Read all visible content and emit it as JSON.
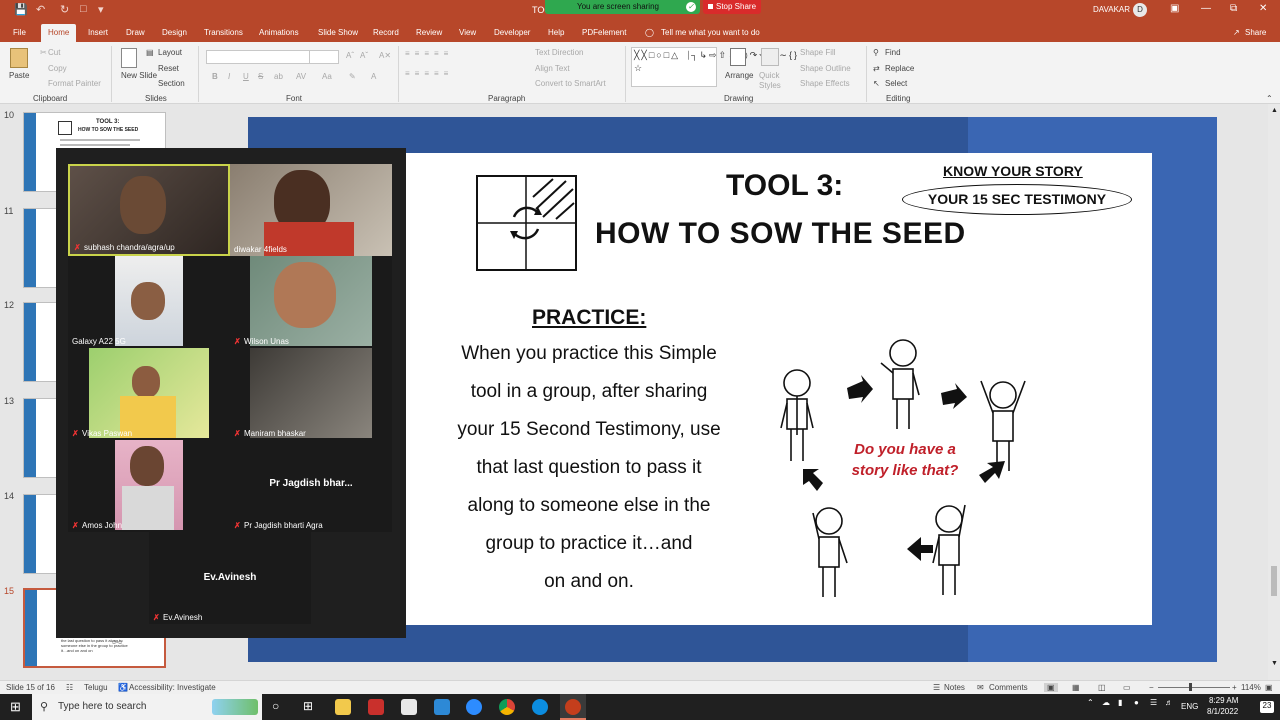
{
  "titlebar": {
    "doc_title": "TOO",
    "sharing_text": "You are screen sharing",
    "stop_share": "Stop Share",
    "user_name": "DAVAKAR",
    "user_initial": "D"
  },
  "menu": {
    "items": [
      "File",
      "Home",
      "Insert",
      "Draw",
      "Design",
      "Transitions",
      "Animations",
      "Slide Show",
      "Record",
      "Review",
      "View",
      "Developer",
      "Help",
      "PDFelement"
    ],
    "tell_me": "Tell me what you want to do",
    "share": "Share"
  },
  "ribbon": {
    "paste": "Paste",
    "cut": "Cut",
    "copy": "Copy",
    "format_painter": "Format Painter",
    "new_slide": "New Slide",
    "layout": "Layout",
    "reset": "Reset",
    "section": "Section",
    "text_direction": "Text Direction",
    "align_text": "Align Text",
    "convert_smartart": "Convert to SmartArt",
    "arrange": "Arrange",
    "quick_styles": "Quick Styles",
    "shape_fill": "Shape Fill",
    "shape_outline": "Shape Outline",
    "shape_effects": "Shape Effects",
    "find": "Find",
    "replace": "Replace",
    "select": "Select",
    "groups": {
      "clipboard": "Clipboard",
      "slides": "Slides",
      "font": "Font",
      "paragraph": "Paragraph",
      "drawing": "Drawing",
      "editing": "Editing"
    },
    "font_buttons": [
      "B",
      "I",
      "U",
      "S",
      "ab",
      "AV",
      "Aa",
      "A"
    ]
  },
  "thumbnails": {
    "numbers": [
      "10",
      "11",
      "12",
      "13",
      "14",
      "15"
    ],
    "thumb10_title": "TOOL 3:",
    "thumb10_sub": "HOW TO SOW THE SEED",
    "thumb15_text": "the last question to pass it along to someone else in the group to practice it…and on and on"
  },
  "slide": {
    "tool_title": "TOOL 3:",
    "tool_subtitle": "HOW TO SOW THE SEED",
    "know_story": "KNOW YOUR STORY",
    "testimony": "YOUR 15 SEC TESTIMONY",
    "practice_heading": "PRACTICE:",
    "practice_lines": [
      "When you practice this Simple",
      "tool in a group, after sharing",
      "your 15 Second Testimony, use",
      "that last question to pass it",
      "along to someone else in the",
      "group to practice it…and",
      "on and on."
    ],
    "question_line1": "Do you have a",
    "question_line2": "story like that?"
  },
  "zoom": {
    "participants": [
      {
        "name": "subhash chandra/agra/up"
      },
      {
        "name": "diwakar 4fields"
      },
      {
        "name": "Galaxy A22 5G"
      },
      {
        "name": "Wilson Unas"
      },
      {
        "name": "Vikas Paswan"
      },
      {
        "name": "Maniram bhaskar"
      },
      {
        "name": "Amos John"
      },
      {
        "name": "Pr  Jagdish bharti  Agra",
        "center": "Pr   Jagdish bhar..."
      },
      {
        "name": "Ev.Avinesh",
        "center": "Ev.Avinesh"
      }
    ]
  },
  "status": {
    "slide_of": "Slide 15 of 16",
    "language": "Telugu",
    "accessibility": "Accessibility: Investigate",
    "notes": "Notes",
    "comments": "Comments",
    "zoom": "114%"
  },
  "taskbar": {
    "search_placeholder": "Type here to search",
    "lang": "ENG",
    "time": "8:29 AM",
    "date": "8/1/2022",
    "notif_count": "23"
  }
}
